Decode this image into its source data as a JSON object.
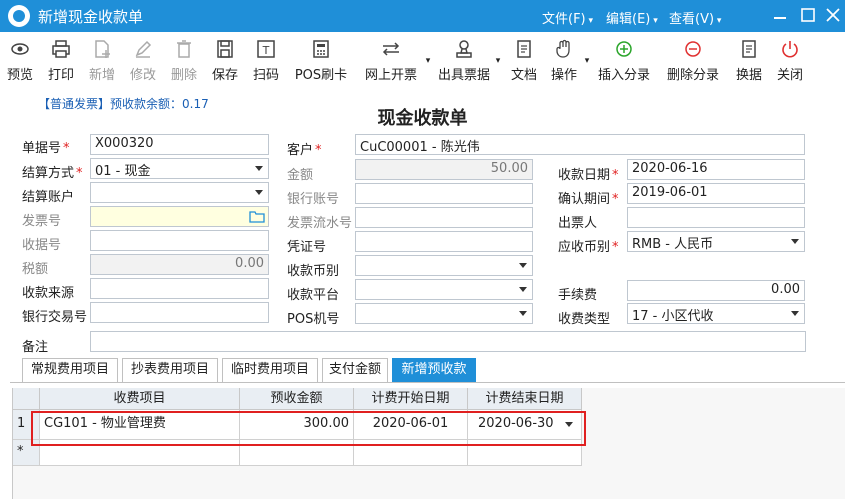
{
  "window": {
    "title": "新增现金收款单"
  },
  "menu": {
    "file": "文件(F)",
    "edit": "编辑(E)",
    "view": "查看(V)"
  },
  "toolbar": {
    "preview": "预览",
    "print": "打印",
    "new": "新增",
    "modify": "修改",
    "delete": "删除",
    "save": "保存",
    "scan": "扫码",
    "pos": "POS刷卡",
    "online_invoice": "网上开票",
    "issue_note": "出具票据",
    "document": "文档",
    "operate": "操作",
    "insert_split": "插入分录",
    "delete_split": "删除分录",
    "swap": "换据",
    "close": "关闭"
  },
  "notice": {
    "invoice_type": "【普通发票】",
    "prepay_label": "预收款余额：",
    "prepay_value": "0.17"
  },
  "form": {
    "title": "现金收款单",
    "doc_no": {
      "label": "单据号",
      "value": "X000320"
    },
    "customer": {
      "label": "客户",
      "value": "CuC00001 - 陈光伟"
    },
    "settle_method": {
      "label": "结算方式",
      "value": "01 - 现金"
    },
    "amount": {
      "label": "金额",
      "value": "50.00"
    },
    "receive_date": {
      "label": "收款日期",
      "value": "2020-06-16"
    },
    "settle_account": {
      "label": "结算账户",
      "value": ""
    },
    "bank_account": {
      "label": "银行账号",
      "value": ""
    },
    "confirm_period": {
      "label": "确认期间",
      "value": "2019-06-01"
    },
    "invoice_no": {
      "label": "发票号",
      "value": ""
    },
    "invoice_serial": {
      "label": "发票流水号",
      "value": ""
    },
    "issuer": {
      "label": "出票人",
      "value": ""
    },
    "receipt_no": {
      "label": "收据号",
      "value": ""
    },
    "voucher_no": {
      "label": "凭证号",
      "value": ""
    },
    "currency": {
      "label": "应收币别",
      "value": "RMB - 人民币"
    },
    "tax": {
      "label": "税额",
      "value": "0.00"
    },
    "receive_currency": {
      "label": "收款币别",
      "value": ""
    },
    "source": {
      "label": "收款来源",
      "value": ""
    },
    "platform": {
      "label": "收款平台",
      "value": ""
    },
    "fee": {
      "label": "手续费",
      "value": "0.00"
    },
    "bank_trade_no": {
      "label": "银行交易号",
      "value": ""
    },
    "pos_no": {
      "label": "POS机号",
      "value": ""
    },
    "fee_type": {
      "label": "收费类型",
      "value": "17 - 小区代收"
    },
    "remark": {
      "label": "备注",
      "value": ""
    }
  },
  "tabs": [
    "常规费用项目",
    "抄表费用项目",
    "临时费用项目",
    "支付金额",
    "新增预收款"
  ],
  "grid": {
    "columns": [
      "收费项目",
      "预收金额",
      "计费开始日期",
      "计费结束日期"
    ],
    "rows": [
      {
        "num": "1",
        "item": "CG101 - 物业管理费",
        "amount": "300.00",
        "start": "2020-06-01",
        "end": "2020-06-30"
      }
    ],
    "new_row_marker": "*"
  }
}
